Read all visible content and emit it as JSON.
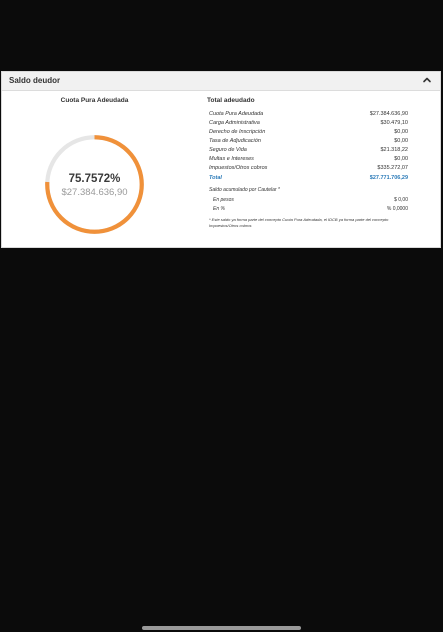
{
  "panel": {
    "title": "Saldo deudor"
  },
  "donut": {
    "title": "Cuota Pura Adeudada",
    "percent_label": "75.7572%",
    "amount_label": "$27.384.636,90",
    "percent_value": 75.7572,
    "color_fill": "#f0913a",
    "color_track": "#e6e6e6"
  },
  "summary": {
    "title": "Total adeudado",
    "rows": [
      {
        "label": "Cuota Pura Adeudada",
        "value": "$27.384.636,90"
      },
      {
        "label": "Carga Administrativa",
        "value": "$30.479,10"
      },
      {
        "label": "Derecho de Inscripción",
        "value": "$0,00"
      },
      {
        "label": "Tasa de Adjudicación",
        "value": "$0,00"
      },
      {
        "label": "Seguro de Vida",
        "value": "$21.318,22"
      },
      {
        "label": "Multas e Intereses",
        "value": "$0,00"
      },
      {
        "label": "Impuestos/Otros cobros",
        "value": "$335.272,07"
      }
    ],
    "total": {
      "label": "Total",
      "value": "$27.771.706,29"
    },
    "saldo_label": "Saldo acumulado por Cautelar *",
    "pesos": {
      "label": "En pesos",
      "value": "$ 0,00"
    },
    "percent": {
      "label": "En %",
      "value": "% 0,0000"
    },
    "note": "* Este saldo ya forma parte del concepto Cuota Pura Adeudada, el IDCB ya forma parte del concepto Impuestos/Otros cobros"
  },
  "icons": {
    "collapse": "chevron-up-icon"
  }
}
